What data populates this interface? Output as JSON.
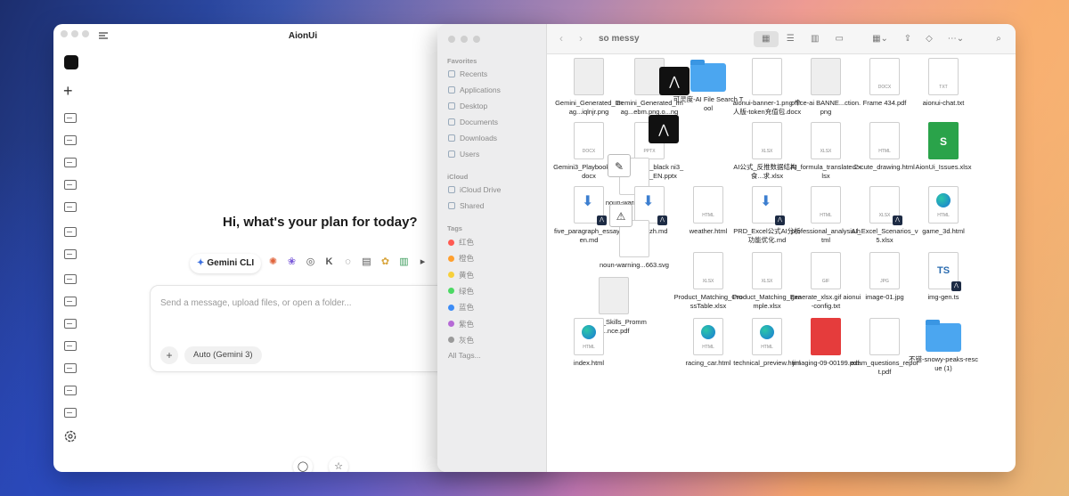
{
  "aion": {
    "title": "AionUi",
    "greeting": "Hi, what's your plan for today?",
    "agent_chip": "Gemini CLI",
    "placeholder": "Send a message, upload files, or open a folder...",
    "attach": "+",
    "mode": "Auto (Gemini 3)"
  },
  "finder": {
    "title": "so messy",
    "sections": {
      "favorites": "Favorites",
      "icloud": "iCloud",
      "tags": "Tags"
    },
    "favorites": [
      "Recents",
      "Applications",
      "Desktop",
      "Documents",
      "Downloads",
      "Users"
    ],
    "icloud": [
      "iCloud Drive",
      "Shared"
    ],
    "tags": [
      {
        "label": "红色",
        "color": "#ff5a52"
      },
      {
        "label": "橙色",
        "color": "#ff9f2e"
      },
      {
        "label": "黄色",
        "color": "#f7d03c"
      },
      {
        "label": "绿色",
        "color": "#4cd964"
      },
      {
        "label": "蓝色",
        "color": "#3c8cf6"
      },
      {
        "label": "紫色",
        "color": "#b66ad6"
      },
      {
        "label": "灰色",
        "color": "#9a9a9a"
      }
    ],
    "all_tags": "All Tags...",
    "files": [
      {
        "name": "Gemini_Generated_Imag...iqlnjr.png",
        "kind": "img",
        "tag": ""
      },
      {
        "name": "Gemini_Generated_Imag...ebm.png.o...ng",
        "kind": "img",
        "tag": ""
      },
      {
        "name": "可灵度-AI File Search Tool",
        "kind": "folder",
        "tag": ""
      },
      {
        "name": "aionui-banner-1.png 个人版-token充值包.docx",
        "kind": "doc",
        "tag": ""
      },
      {
        "name": "office-ai BANNE...ction.png",
        "kind": "img",
        "tag": ""
      },
      {
        "name": "Frame 434.pdf",
        "kind": "doc",
        "tag": "DOCX"
      },
      {
        "name": "aionui-chat.txt",
        "kind": "doc",
        "tag": "TXT"
      },
      {
        "name": "Gemini3_Playbook_EN.docx",
        "kind": "doc",
        "tag": "DOCX"
      },
      {
        "name": "aionui_logo_black ni3_Playbook_EN.pptx",
        "kind": "doc",
        "tag": "PPTX"
      },
      {
        "name": "AI公式_反推数据结构_食...求.xlsx",
        "kind": "doc",
        "tag": "XLSX"
      },
      {
        "name": "AI_formula_translated.xlsx",
        "kind": "doc",
        "tag": "XLSX"
      },
      {
        "name": "2-cute_drawing.html",
        "kind": "doc",
        "tag": "HTML"
      },
      {
        "name": "AionUi_Issues.xlsx",
        "kind": "sheet",
        "tag": "S"
      },
      {
        "name": "noun-warning...164",
        "kind": "doc",
        "tag": ""
      },
      {
        "name": "five_paragraph_essay_en.md",
        "kind": "dl",
        "tag": ""
      },
      {
        "name": "story_zh.md",
        "kind": "dl",
        "tag": ""
      },
      {
        "name": "weather.html",
        "kind": "doc",
        "tag": "HTML"
      },
      {
        "name": "PRD_Excel公式AI分析功能优化.md",
        "kind": "dl",
        "tag": ""
      },
      {
        "name": "professional_analysis.html",
        "kind": "doc",
        "tag": "HTML"
      },
      {
        "name": "AI_Excel_Scenarios_v5.xlsx",
        "kind": "doc",
        "tag": "XLSX"
      },
      {
        "name": "game_3d.html",
        "kind": "edge",
        "tag": "HTML"
      },
      {
        "name": "noun-warning...663.svg",
        "kind": "doc",
        "tag": ""
      },
      {
        "name": "Product_Matching_CrossTable.xlsx",
        "kind": "doc",
        "tag": "XLSX"
      },
      {
        "name": "Product_Matching_Example.xlsx",
        "kind": "doc",
        "tag": "XLSX"
      },
      {
        "name": "generate_xlsx.gif aionui-config.txt",
        "kind": "doc",
        "tag": "GIF"
      },
      {
        "name": "image-01.jpg",
        "kind": "doc",
        "tag": "JPG"
      },
      {
        "name": "img-gen.ts",
        "kind": "ts",
        "tag": "TS"
      },
      {
        "name": "Claude_Skills_Promma...nce.pdf",
        "kind": "img",
        "tag": ""
      },
      {
        "name": "index.html",
        "kind": "edge",
        "tag": "HTML"
      },
      {
        "name": "racing_car.html",
        "kind": "edge",
        "tag": "HTML"
      },
      {
        "name": "technical_preview.html",
        "kind": "edge",
        "tag": "HTML"
      },
      {
        "name": "jimaging-09-00199.pdf",
        "kind": "pdfred",
        "tag": ""
      },
      {
        "name": "exam_questions_report.pdf",
        "kind": "doc",
        "tag": ""
      },
      {
        "name": "不错-snowy-peaks-rescue (1)",
        "kind": "folder",
        "tag": ""
      }
    ]
  }
}
